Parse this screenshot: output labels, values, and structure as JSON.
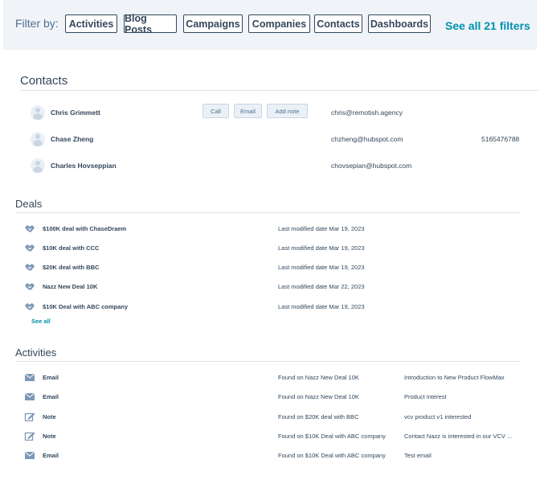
{
  "filter_bar": {
    "label": "Filter by:",
    "chips": [
      "Activities",
      "Blog Posts",
      "Campaigns",
      "Companies",
      "Contacts",
      "Dashboards"
    ],
    "see_all": "See all 21 filters"
  },
  "contacts": {
    "title": "Contacts",
    "actions": [
      "Call",
      "Email",
      "Add note"
    ],
    "items": [
      {
        "name": "Chris Grimmett",
        "email": "chris@remotish.agency",
        "phone": ""
      },
      {
        "name": "Chase Zheng",
        "email": "chzheng@hubspot.com",
        "phone": "5165476788"
      },
      {
        "name": "Charles Hovseppian",
        "email": "chovsepian@hubspot.com",
        "phone": ""
      }
    ]
  },
  "deals": {
    "title": "Deals",
    "see_all": "See all",
    "items": [
      {
        "name": "$100K deal with ChaseDraem",
        "modified": "Last modified date Mar 19, 2023"
      },
      {
        "name": "$10K deal with CCC",
        "modified": "Last modified date Mar 19, 2023"
      },
      {
        "name": "$20K deal with BBC",
        "modified": "Last modified date Mar 19, 2023"
      },
      {
        "name": "Nazz New Deal 10K",
        "modified": "Last modified date Mar 22, 2023"
      },
      {
        "name": "$10K Deal with ABC company",
        "modified": "Last modified date Mar 19, 2023"
      }
    ]
  },
  "activities": {
    "title": "Activities",
    "items": [
      {
        "type": "Email",
        "icon": "envelope-icon",
        "found": "Found on Nazz New Deal 10K",
        "subject": "Introduction to New Product FlowMax"
      },
      {
        "type": "Email",
        "icon": "envelope-icon",
        "found": "Found on Nazz New Deal 10K",
        "subject": "Product interest"
      },
      {
        "type": "Note",
        "icon": "note-icon",
        "found": "Found on $20K deal with BBC",
        "subject": "vcv product v1 interested"
      },
      {
        "type": "Note",
        "icon": "note-icon",
        "found": "Found on $10K Deal with ABC company",
        "subject": "Contact Nazz is interested in our VCV ..."
      },
      {
        "type": "Email",
        "icon": "envelope-icon",
        "found": "Found on $10K Deal with ABC company",
        "subject": "Test email"
      }
    ]
  },
  "colors": {
    "link": "#0091ae",
    "text": "#33475b",
    "filter_bg": "#f0f4f8",
    "icon": "#516f90"
  }
}
